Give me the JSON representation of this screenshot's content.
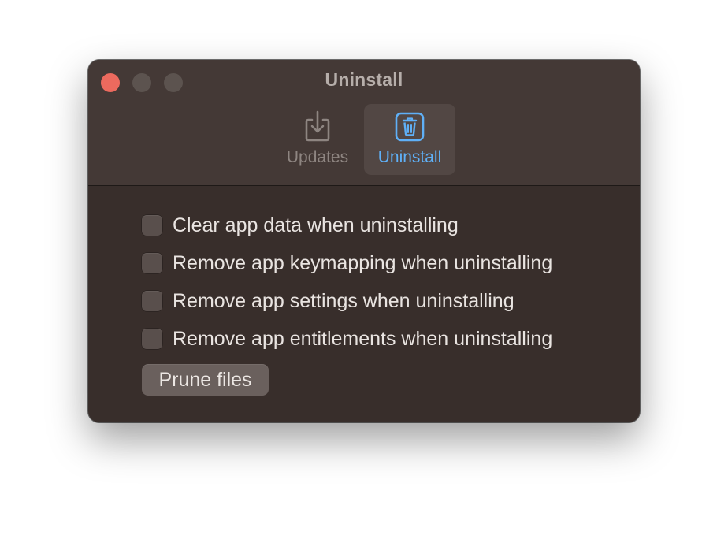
{
  "window": {
    "title": "Uninstall"
  },
  "toolbar": {
    "items": [
      {
        "label": "Updates",
        "icon": "download-tray-icon",
        "selected": false
      },
      {
        "label": "Uninstall",
        "icon": "trash-icon",
        "selected": true
      }
    ]
  },
  "options": [
    {
      "label": "Clear app data when uninstalling",
      "checked": false
    },
    {
      "label": "Remove app keymapping when uninstalling",
      "checked": false
    },
    {
      "label": "Remove app settings when uninstalling",
      "checked": false
    },
    {
      "label": "Remove app entitlements when uninstalling",
      "checked": false
    }
  ],
  "actions": {
    "prune_label": "Prune files"
  },
  "colors": {
    "accent": "#5fb0f7",
    "close": "#ec6a5e",
    "background": "#382e2b",
    "titlebar": "#443936"
  }
}
